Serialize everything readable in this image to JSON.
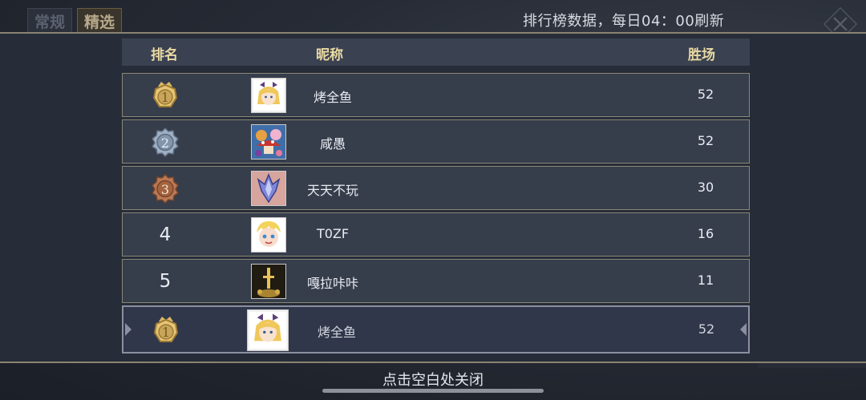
{
  "top_tabs": [
    {
      "label": "常规"
    },
    {
      "label": "精选"
    }
  ],
  "refresh_note": "排行榜数据，每日04：00刷新",
  "header": {
    "rank": "排名",
    "name": "昵称",
    "wins": "胜场"
  },
  "rows": [
    {
      "rank": "1",
      "rank_style": "gold-medal",
      "avatar_icon": "blonde-girl-avatar",
      "name": "烤全鱼",
      "wins": "52"
    },
    {
      "rank": "2",
      "rank_style": "silver-medal",
      "avatar_icon": "mushroom-group-avatar",
      "name": "咸愚",
      "wins": "52"
    },
    {
      "rank": "3",
      "rank_style": "bronze-medal",
      "avatar_icon": "crystal-avatar",
      "name": "天天不玩",
      "wins": "30"
    },
    {
      "rank": "4",
      "rank_style": "plain",
      "avatar_icon": "blonde-boy-avatar",
      "name": "T0ZF",
      "wins": "16"
    },
    {
      "rank": "5",
      "rank_style": "plain",
      "avatar_icon": "golden-sword-avatar",
      "name": "嘎拉咔咔",
      "wins": "11"
    }
  ],
  "self_row": {
    "rank": "1",
    "rank_style": "gold-medal",
    "avatar_icon": "blonde-girl-avatar",
    "name": "烤全鱼",
    "wins": "52"
  },
  "footer_hint": "点击空白处关闭",
  "colors": {
    "gold": "#d8b767",
    "silver": "#8fa1b6",
    "bronze": "#b0714c",
    "header_text": "#e9d9a3"
  }
}
